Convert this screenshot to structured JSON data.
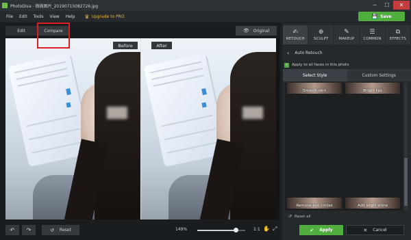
{
  "window": {
    "title": "PhotoDiva - 微微图片_20190715082726.jpg",
    "minimize": "─",
    "maximize": "☐",
    "close": "✕"
  },
  "menu": {
    "items": [
      "File",
      "Edit",
      "Tools",
      "View",
      "Help"
    ],
    "upgrade": "Upgrade to PRO",
    "save": "Save"
  },
  "viewer": {
    "tab_edit": "Edit",
    "tab_compare": "Compare",
    "original": "Original",
    "before": "Before",
    "after": "After"
  },
  "bottom": {
    "reset": "Reset",
    "zoom": "149%",
    "zoom_fraction": 0.8,
    "one_to_one": "1:1"
  },
  "tools": [
    {
      "label": "RETOUCH",
      "icon": "retouch-icon",
      "glyph": "✍",
      "active": true
    },
    {
      "label": "SCULPT",
      "icon": "sculpt-icon",
      "glyph": "⊕",
      "active": false
    },
    {
      "label": "MAKEUP",
      "icon": "makeup-icon",
      "glyph": "✎",
      "active": false
    },
    {
      "label": "COMMON",
      "icon": "sliders-icon",
      "glyph": "☰",
      "active": false
    },
    {
      "label": "EFFECTS",
      "icon": "effects-icon",
      "glyph": "⧉",
      "active": false
    }
  ],
  "panel": {
    "title": "Auto Retouch",
    "apply_all_faces": "Apply to all faces in this photo",
    "select_style": "Select Style",
    "custom_settings": "Custom Settings",
    "styles": [
      "Smooth skin",
      "Bright lips",
      "Remove eye circles",
      "Add slight shine"
    ],
    "reset_all": "Reset all",
    "apply": "Apply",
    "cancel": "Cancel"
  },
  "colors": {
    "accent": "#4fae3e",
    "highlight": "#e02020",
    "upgrade": "#e6b84a"
  }
}
